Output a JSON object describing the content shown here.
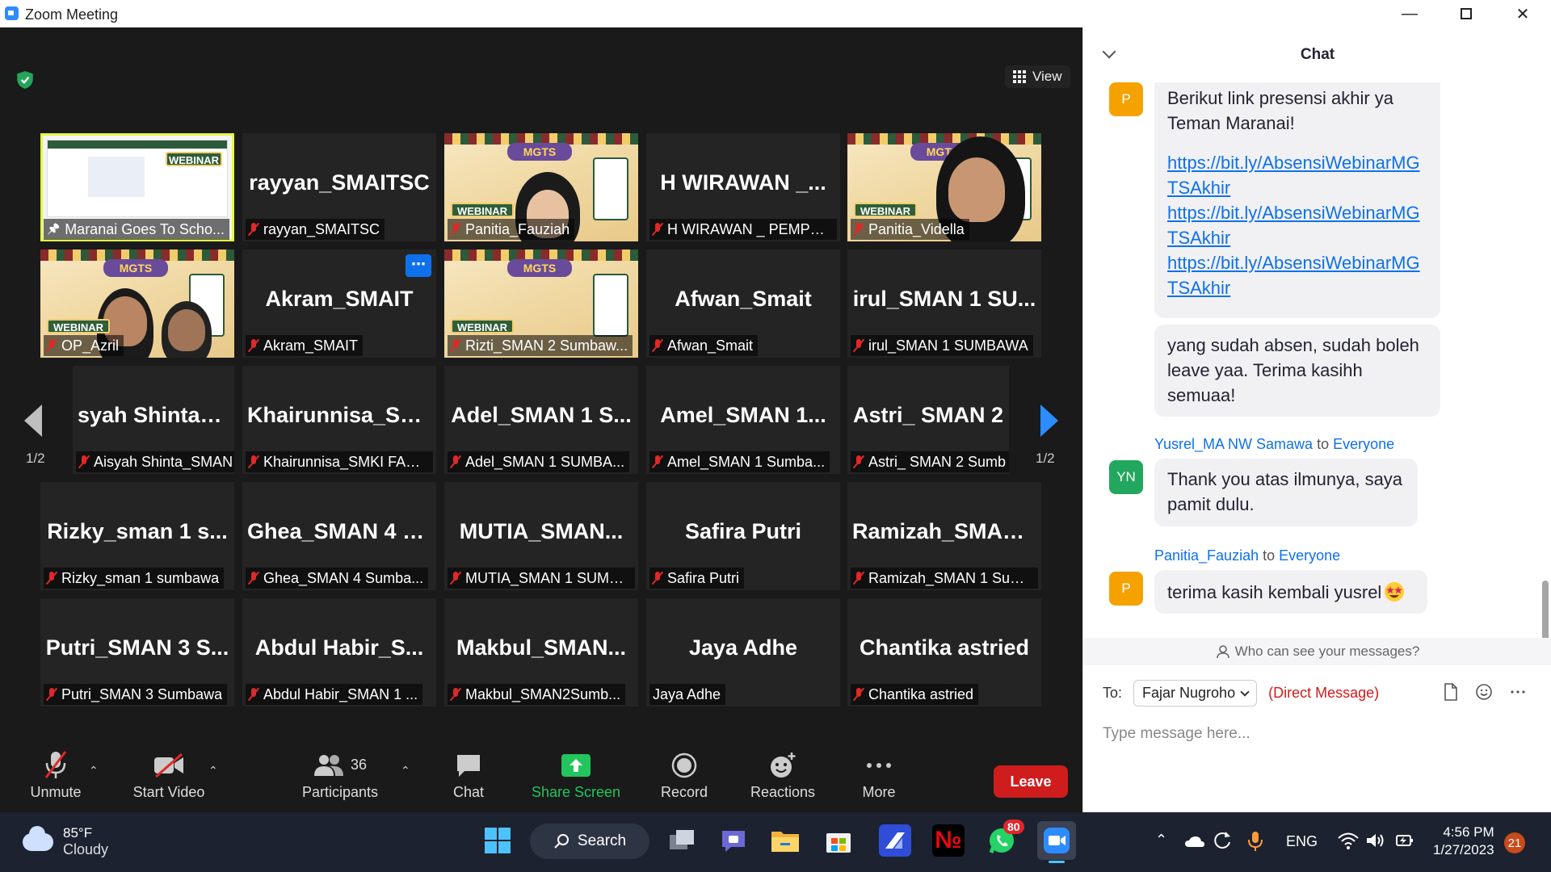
{
  "window": {
    "title": "Zoom Meeting"
  },
  "view_label": "View",
  "tiles": [
    {
      "name": "Maranai Goes To Scho...",
      "kind": "screen"
    },
    {
      "name": "rayyan_SMAITSC",
      "big": "rayyan_SMAITSC",
      "kind": "name"
    },
    {
      "name": "Panitia_Fauziah",
      "kind": "video"
    },
    {
      "name": "H WIRAWAN _ PEMPR...",
      "big": "H WIRAWAN _...",
      "kind": "name"
    },
    {
      "name": "Panitia_Vidella",
      "kind": "video"
    },
    {
      "name": "OP_Azril",
      "kind": "video"
    },
    {
      "name": "Akram_SMAIT",
      "big": "Akram_SMAIT",
      "kind": "name"
    },
    {
      "name": "Rizti_SMAN 2 Sumbaw...",
      "kind": "video"
    },
    {
      "name": "Afwan_Smait",
      "big": "Afwan_Smait",
      "kind": "name"
    },
    {
      "name": "irul_SMAN 1 SUMBAWA",
      "big": "irul_SMAN 1 SU...",
      "kind": "name"
    },
    {
      "name": "Aisyah Shinta_SMAN 1...",
      "big": "syah Shinta_S...",
      "kind": "name"
    },
    {
      "name": "Khairunnisa_SMKI FAR...",
      "big": "Khairunnisa_SM...",
      "kind": "name"
    },
    {
      "name": "Adel_SMAN 1 SUMBA...",
      "big": "Adel_SMAN 1 S...",
      "kind": "name"
    },
    {
      "name": "Amel_SMAN 1 Sumba...",
      "big": "Amel_SMAN 1...",
      "kind": "name"
    },
    {
      "name": "Astri_ SMAN 2 Sumb",
      "big": "Astri_ SMAN 2",
      "kind": "name"
    },
    {
      "name": "Rizky_sman 1 sumbawa",
      "big": "Rizky_sman 1 s...",
      "kind": "name"
    },
    {
      "name": "Ghea_SMAN 4 Sumba...",
      "big": "Ghea_SMAN 4 S...",
      "kind": "name"
    },
    {
      "name": "MUTIA_SMAN 1 SUMB...",
      "big": "MUTIA_SMAN...",
      "kind": "name"
    },
    {
      "name": "Safira Putri",
      "big": "Safira Putri",
      "kind": "name"
    },
    {
      "name": "Ramizah_SMAN 1 Sum...",
      "big": "Ramizah_SMAN...",
      "kind": "name"
    },
    {
      "name": "Putri_SMAN 3 Sumbawa",
      "big": "Putri_SMAN 3 S...",
      "kind": "name"
    },
    {
      "name": "Abdul Habir_SMAN 1 ...",
      "big": "Abdul Habir_S...",
      "kind": "name"
    },
    {
      "name": "Makbul_SMAN2Sumb...",
      "big": "Makbul_SMAN...",
      "kind": "name"
    },
    {
      "name": "Jaya Adhe",
      "big": "Jaya Adhe",
      "kind": "name",
      "unmuted": true
    },
    {
      "name": "Chantika astried",
      "big": "Chantika astried",
      "kind": "name"
    }
  ],
  "tile_text": {
    "webinar": "WEBINAR",
    "mgts": "MGTS"
  },
  "pager": {
    "left": "1/2",
    "right": "1/2"
  },
  "toolbar": {
    "unmute": "Unmute",
    "start_video": "Start Video",
    "participants": "Participants",
    "participants_count": "36",
    "chat": "Chat",
    "share_screen": "Share Screen",
    "record": "Record",
    "reactions": "Reactions",
    "more": "More",
    "leave": "Leave"
  },
  "chat": {
    "title": "Chat",
    "messages": [
      {
        "avatar": "P",
        "text": "Berikut link presensi akhir ya Teman Maranai!",
        "links": [
          "https://bit.ly/AbsensiWebinarMGTSAkhir",
          "https://bit.ly/AbsensiWebinarMGTSAkhir",
          "https://bit.ly/AbsensiWebinarMGTSAkhir"
        ]
      },
      {
        "text": "yang sudah absen, sudah boleh leave yaa. Terima kasihh semuaa!"
      },
      {
        "sender": "Yusrel_MA NW Samawa",
        "to": "to",
        "target": "Everyone",
        "avatar": "YN",
        "text": "Thank you atas ilmunya, saya pamit dulu."
      },
      {
        "sender": "Panitia_Fauziah",
        "to": "to",
        "target": "Everyone",
        "avatar": "P",
        "text": "terima kasih kembali yusrel"
      }
    ],
    "who_can_see": "Who can see your messages?",
    "to_label": "To:",
    "recipient": "Fajar Nugroho",
    "direct_message": "(Direct Message)",
    "input_placeholder": "Type message here...",
    "colors": {
      "avatar_p": "#f5a201",
      "avatar_yn": "#22a75e",
      "link": "#0e71eb"
    }
  },
  "taskbar": {
    "temp": "85°F",
    "condition": "Cloudy",
    "search": "Search",
    "whatsapp_badge": "80",
    "lang": "ENG",
    "time": "4:56 PM",
    "date": "1/27/2023",
    "notifications": "21"
  }
}
